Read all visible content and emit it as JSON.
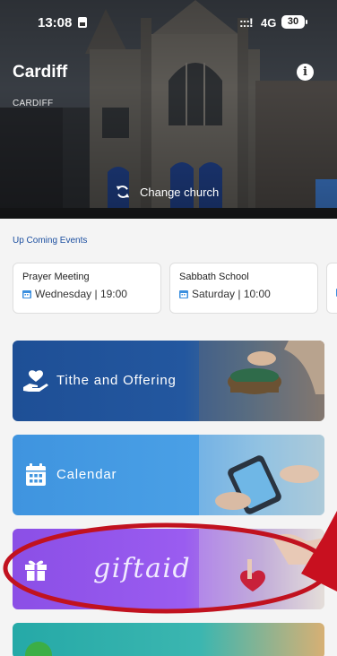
{
  "status_bar": {
    "time": "13:08",
    "signal": ":::!",
    "network": "4G",
    "battery": "30"
  },
  "header": {
    "church_name": "Cardiff",
    "church_subtitle": "CARDIFF",
    "info_icon": "info-icon",
    "change_church_label": "Change church",
    "change_church_icon": "refresh-icon"
  },
  "upcoming": {
    "title": "Up Coming Events",
    "events": [
      {
        "title": "Prayer Meeting",
        "when": "Wednesday | 19:00"
      },
      {
        "title": "Sabbath School",
        "when": "Saturday | 10:00"
      },
      {
        "title": "",
        "when": ""
      }
    ]
  },
  "tiles": [
    {
      "label": "Tithe and Offering",
      "icon": "hand-heart-icon",
      "color": "#1e4f96"
    },
    {
      "label": "Calendar",
      "icon": "calendar-icon",
      "color": "#3f94df"
    },
    {
      "label": "giftaid",
      "icon": "gift-icon",
      "color": "#8b4fe6"
    },
    {
      "label": "",
      "icon": "",
      "color": "#25a9a7"
    }
  ],
  "annotation": {
    "highlight_color": "#c1121f"
  }
}
